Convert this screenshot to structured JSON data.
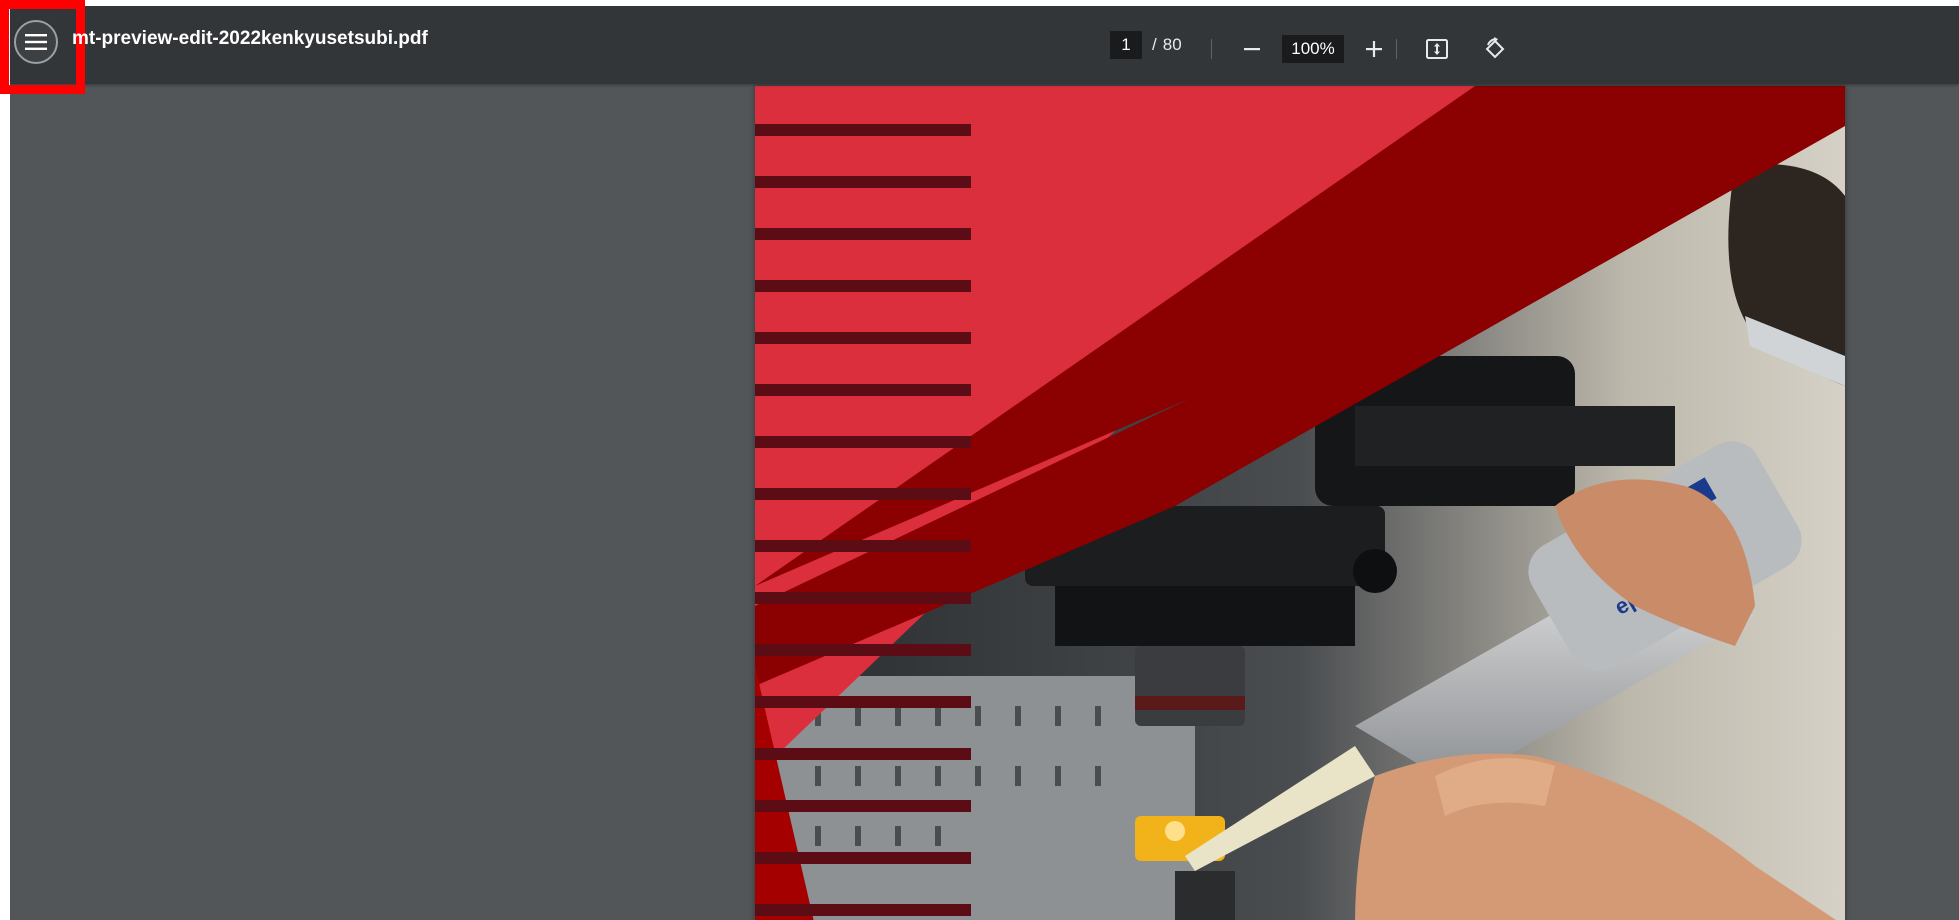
{
  "toolbar": {
    "menu_icon": "menu-icon",
    "title": "mt-preview-edit-2022kenkyusetsubi.pdf",
    "current_page": "1",
    "page_separator": "/",
    "total_pages": "80",
    "zoom_level": "100%",
    "zoom_out_icon": "minus-icon",
    "zoom_in_icon": "plus-icon",
    "fit_page_icon": "fit-to-page-icon",
    "rotate_icon": "rotate-counterclockwise-icon"
  },
  "document": {
    "cover_photo_label": "Eppendorf pipette and microscope laboratory photo",
    "pipette_brand": "epper",
    "accent_color": "#dc2f3d",
    "dark_red": "#8b0000",
    "stripe_color": "#5c0c14"
  }
}
